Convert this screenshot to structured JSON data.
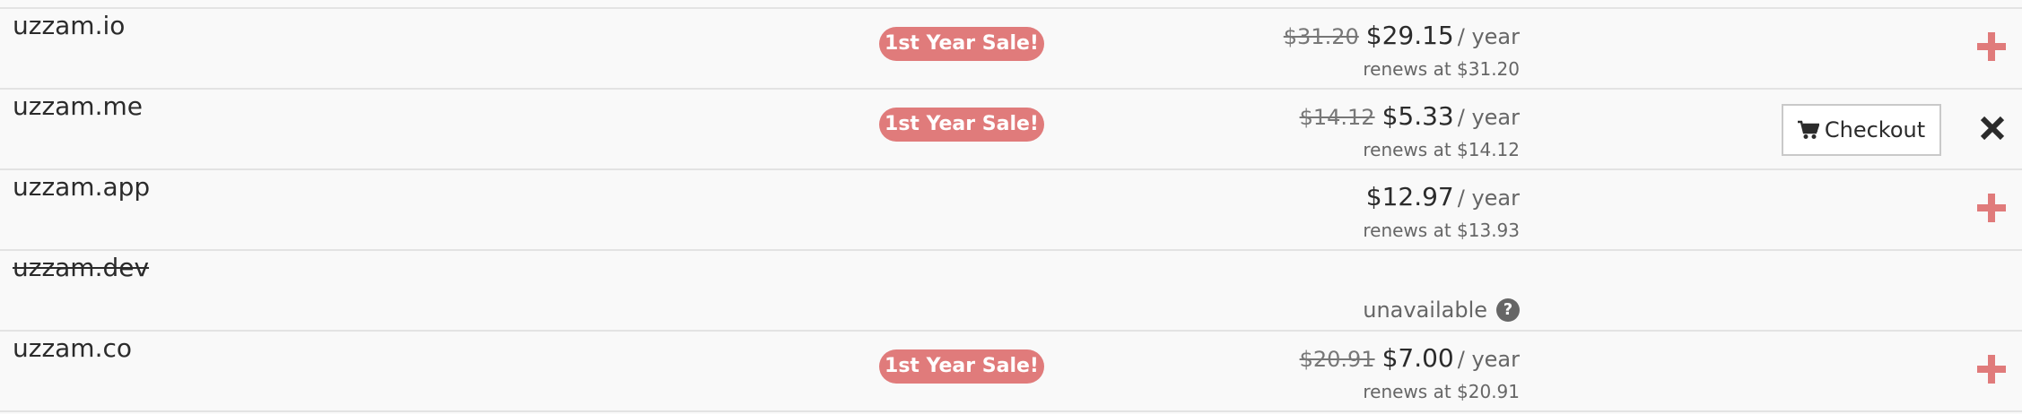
{
  "colors": {
    "sale_badge": "#e07b7b",
    "add_icon": "#e07b7b",
    "border": "#e3e3e3",
    "text_dark": "#2b2b2b",
    "text_muted": "#666666"
  },
  "rows": [
    {
      "domain": "uzzam.io",
      "badge": "1st Year Sale!",
      "old_price": "$31.20",
      "price": "$29.15",
      "per": "/ year",
      "renews": "renews at $31.20",
      "action_icon": "plus-icon"
    },
    {
      "domain": "uzzam.me",
      "badge": "1st Year Sale!",
      "old_price": "$14.12",
      "price": "$5.33",
      "per": "/ year",
      "renews": "renews at $14.12",
      "checkout_label": "Checkout",
      "checkout_icon": "cart-icon",
      "action_icon": "close-icon"
    },
    {
      "domain": "uzzam.app",
      "price": "$12.97",
      "per": "/ year",
      "renews": "renews at $13.93",
      "action_icon": "plus-icon"
    },
    {
      "domain": "uzzam.dev",
      "status": "unavailable",
      "status_icon": "question-circle-icon"
    },
    {
      "domain": "uzzam.co",
      "badge": "1st Year Sale!",
      "old_price": "$20.91",
      "price": "$7.00",
      "per": "/ year",
      "renews": "renews at $20.91",
      "action_icon": "plus-icon"
    }
  ]
}
